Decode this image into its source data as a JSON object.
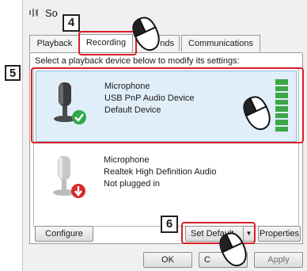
{
  "window": {
    "title": "So",
    "icon": "speaker-icon"
  },
  "tabs": [
    {
      "label": "Playback",
      "active": false
    },
    {
      "label": "Recording",
      "active": true
    },
    {
      "label": "nds",
      "active": false
    },
    {
      "label": "Communications",
      "active": false
    }
  ],
  "instruction": "Select a playback device below to modify its settings:",
  "devices": [
    {
      "name": "Microphone",
      "detail": "USB PnP Audio Device",
      "status": "Default Device",
      "icon": "microphone-icon",
      "badge": "default-check-icon",
      "selected": true,
      "level_bars": 8
    },
    {
      "name": "Microphone",
      "detail": "Realtek High Definition Audio",
      "status": "Not plugged in",
      "icon": "microphone-icon",
      "badge": "unplugged-arrow-icon",
      "selected": false
    }
  ],
  "buttons": {
    "configure": "Configure",
    "set_default": "Set Default",
    "properties": "Properties",
    "ok": "OK",
    "cancel": "C",
    "apply": "Apply"
  },
  "callouts": {
    "step4": "4",
    "step5": "5",
    "step6": "6"
  },
  "colors": {
    "highlight": "#d81f2a",
    "selection": "#e0eef9",
    "level_meter": "#3aa845",
    "default_badge": "#2ea84a",
    "unplugged_badge": "#d42a2a"
  }
}
